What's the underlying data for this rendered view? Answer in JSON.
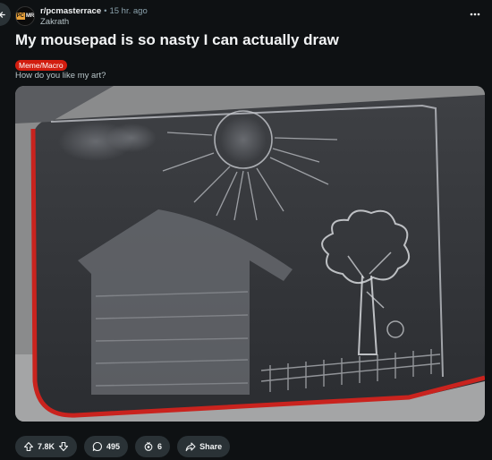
{
  "post": {
    "subreddit": "r/pcmasterrace",
    "separator": "•",
    "time": "15 hr. ago",
    "author": "Zakrath",
    "avatar": {
      "left": "PC",
      "right": "MR"
    },
    "title": "My mousepad is so nasty I can actually draw",
    "flair": "Meme/Macro",
    "body": "How do you like my art?",
    "flair_color": "#d21d0f"
  },
  "actions": {
    "votes": "7.8K",
    "comments": "495",
    "awards": "6",
    "share": "Share"
  },
  "icons": {
    "back": "arrow-left-icon",
    "more": "more-horizontal-icon",
    "upvote": "upvote-arrow-icon",
    "downvote": "downvote-arrow-icon",
    "comment": "comment-bubble-icon",
    "award": "award-icon",
    "share": "share-arrow-icon"
  }
}
